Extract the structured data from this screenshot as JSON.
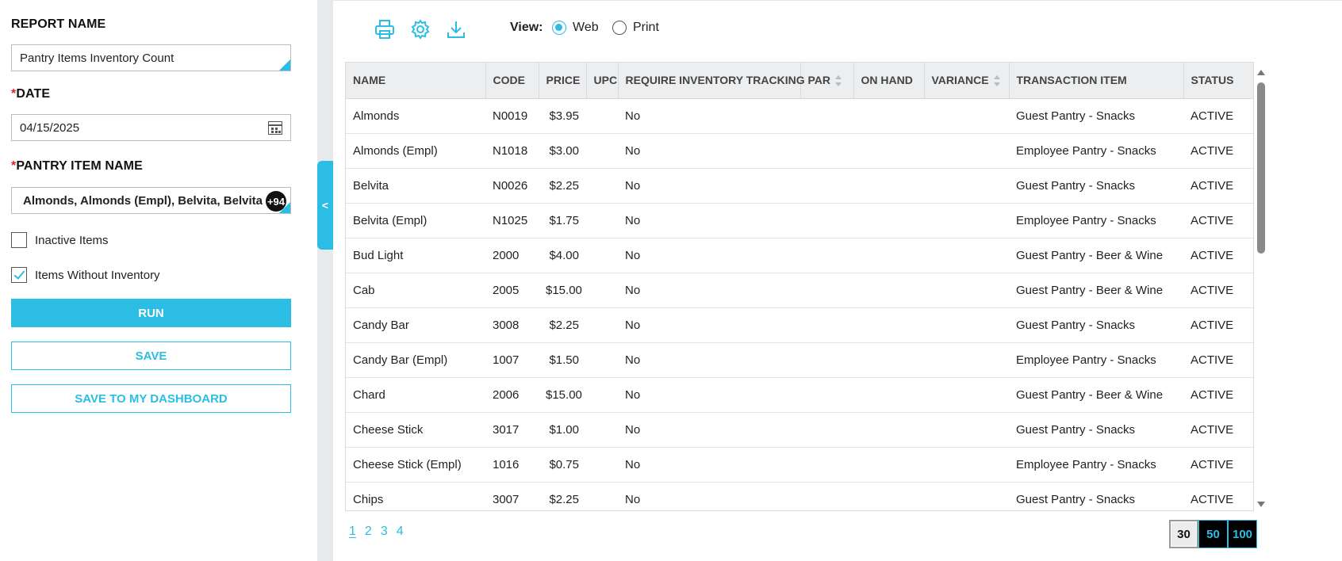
{
  "form": {
    "report_name_label": "REPORT NAME",
    "report_name_value": "Pantry Items Inventory Count",
    "date_required": "*",
    "date_label": "DATE",
    "date_value": "04/15/2025",
    "pantry_required": "*",
    "pantry_label": "PANTRY ITEM NAME",
    "pantry_value": "Almonds, Almonds (Empl), Belvita, Belvita (...",
    "pantry_more_count": "+94",
    "inactive_label": "Inactive Items",
    "inactive_checked": false,
    "without_inventory_label": "Items Without Inventory",
    "without_inventory_checked": true,
    "run_label": "RUN",
    "save_label": "SAVE",
    "save_dashboard_label": "SAVE TO MY DASHBOARD"
  },
  "collapse_label": "<",
  "toolbar": {
    "icons": [
      "print-icon",
      "settings-gear-icon",
      "download-icon"
    ],
    "view_label": "View:",
    "view_options": [
      "Web",
      "Print"
    ],
    "view_selected": "Web",
    "accent_color": "#2bbde3"
  },
  "table": {
    "columns": [
      "NAME",
      "CODE",
      "PRICE",
      "UPC",
      "REQUIRE INVENTORY TRACKING",
      "PAR",
      "ON HAND",
      "VARIANCE",
      "TRANSACTION ITEM",
      "STATUS"
    ],
    "rows": [
      [
        "Almonds",
        "N0019",
        "$3.95",
        "",
        "No",
        "",
        "",
        "",
        "Guest Pantry - Snacks",
        "ACTIVE"
      ],
      [
        "Almonds (Empl)",
        "N1018",
        "$3.00",
        "",
        "No",
        "",
        "",
        "",
        "Employee Pantry - Snacks",
        "ACTIVE"
      ],
      [
        "Belvita",
        "N0026",
        "$2.25",
        "",
        "No",
        "",
        "",
        "",
        "Guest Pantry - Snacks",
        "ACTIVE"
      ],
      [
        "Belvita (Empl)",
        "N1025",
        "$1.75",
        "",
        "No",
        "",
        "",
        "",
        "Employee Pantry - Snacks",
        "ACTIVE"
      ],
      [
        "Bud Light",
        "2000",
        "$4.00",
        "",
        "No",
        "",
        "",
        "",
        "Guest Pantry - Beer & Wine",
        "ACTIVE"
      ],
      [
        "Cab",
        "2005",
        "$15.00",
        "",
        "No",
        "",
        "",
        "",
        "Guest Pantry - Beer & Wine",
        "ACTIVE"
      ],
      [
        "Candy Bar",
        "3008",
        "$2.25",
        "",
        "No",
        "",
        "",
        "",
        "Guest Pantry - Snacks",
        "ACTIVE"
      ],
      [
        "Candy Bar (Empl)",
        "1007",
        "$1.50",
        "",
        "No",
        "",
        "",
        "",
        "Employee Pantry - Snacks",
        "ACTIVE"
      ],
      [
        "Chard",
        "2006",
        "$15.00",
        "",
        "No",
        "",
        "",
        "",
        "Guest Pantry - Beer & Wine",
        "ACTIVE"
      ],
      [
        "Cheese Stick",
        "3017",
        "$1.00",
        "",
        "No",
        "",
        "",
        "",
        "Guest Pantry - Snacks",
        "ACTIVE"
      ],
      [
        "Cheese Stick (Empl)",
        "1016",
        "$0.75",
        "",
        "No",
        "",
        "",
        "",
        "Employee Pantry - Snacks",
        "ACTIVE"
      ],
      [
        "Chips",
        "3007",
        "$2.25",
        "",
        "No",
        "",
        "",
        "",
        "Guest Pantry - Snacks",
        "ACTIVE"
      ]
    ]
  },
  "pagination": {
    "pages": [
      "1",
      "2",
      "3",
      "4"
    ],
    "current_page": "1",
    "page_sizes": [
      "30",
      "50",
      "100"
    ],
    "selected_page_size": "30"
  }
}
